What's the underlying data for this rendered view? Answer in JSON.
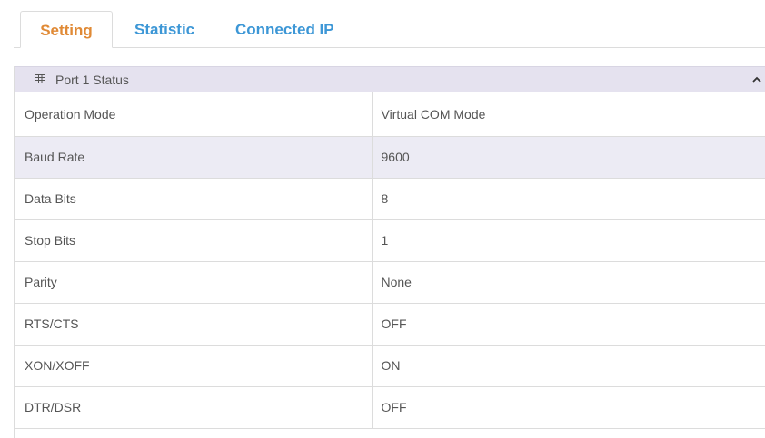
{
  "tabs": [
    {
      "label": "Setting",
      "active": true
    },
    {
      "label": "Statistic",
      "active": false
    },
    {
      "label": "Connected IP",
      "active": false
    }
  ],
  "colors": {
    "tab_active": "#e08a36",
    "tab_inactive": "#3d97d6",
    "panel_header_bg": "#e5e2ef",
    "row_highlight_bg": "#ecebf4",
    "text": "#555555"
  },
  "panel": {
    "title": "Port 1 Status",
    "title_icon": "grid-table-icon",
    "collapse_icon": "chevron-up-icon"
  },
  "rows": [
    {
      "label": "Operation Mode",
      "value": "Virtual COM Mode"
    },
    {
      "label": "Baud Rate",
      "value": "9600"
    },
    {
      "label": "Data Bits",
      "value": "8"
    },
    {
      "label": "Stop Bits",
      "value": "1"
    },
    {
      "label": "Parity",
      "value": "None"
    },
    {
      "label": "RTS/CTS",
      "value": "OFF"
    },
    {
      "label": "XON/XOFF",
      "value": "ON"
    },
    {
      "label": "DTR/DSR",
      "value": "OFF"
    }
  ],
  "highlighted_row": "Baud Rate"
}
